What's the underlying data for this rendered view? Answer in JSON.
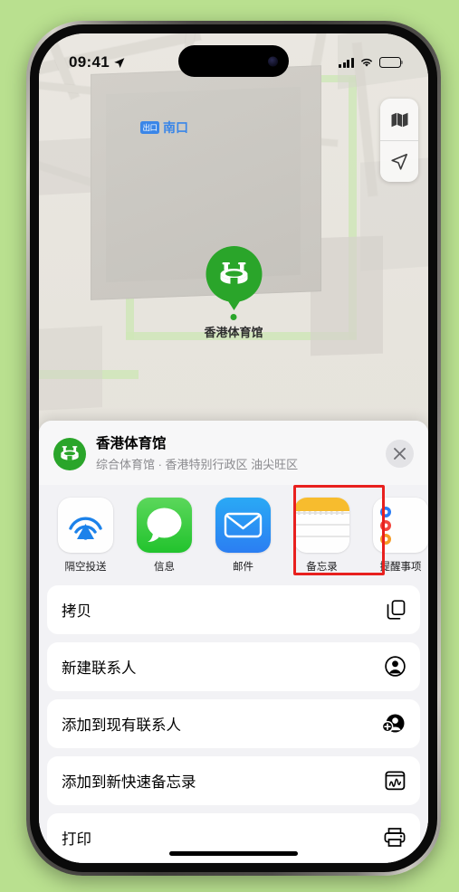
{
  "status_bar": {
    "time": "09:41",
    "location_arrow": "location-arrow-icon",
    "cellular": "cellular-bars-icon",
    "wifi": "wifi-icon",
    "battery": "battery-icon"
  },
  "map": {
    "controls": [
      {
        "name": "map-mode-button",
        "icon": "folded-map-icon"
      },
      {
        "name": "recenter-button",
        "icon": "navigation-arrow-icon"
      }
    ],
    "exit_label": {
      "badge": "出口",
      "text": "南口"
    },
    "pin": {
      "label": "香港体育馆",
      "icon": "stadium-icon",
      "color": "#2aa52a"
    }
  },
  "share_sheet": {
    "title": "香港体育馆",
    "subtitle": "综合体育馆 · 香港特别行政区 油尖旺区",
    "avatar_icon": "stadium-icon",
    "close_label": "✕",
    "apps": [
      {
        "label": "隔空投送",
        "icon": "airdrop-icon",
        "highlighted": false
      },
      {
        "label": "信息",
        "icon": "messages-icon",
        "highlighted": false
      },
      {
        "label": "邮件",
        "icon": "mail-icon",
        "highlighted": false
      },
      {
        "label": "备忘录",
        "icon": "notes-icon",
        "highlighted": true
      },
      {
        "label": "提醒事项",
        "icon": "reminders-icon",
        "highlighted": false
      }
    ],
    "action_groups": [
      {
        "rows": [
          {
            "label": "拷贝",
            "icon": "copy-icon"
          }
        ]
      },
      {
        "rows": [
          {
            "label": "新建联系人",
            "icon": "person-circle-icon"
          }
        ]
      },
      {
        "rows": [
          {
            "label": "添加到现有联系人",
            "icon": "person-add-icon"
          }
        ]
      },
      {
        "rows": [
          {
            "label": "添加到新快速备忘录",
            "icon": "quick-note-icon"
          }
        ]
      },
      {
        "rows": [
          {
            "label": "打印",
            "icon": "printer-icon"
          }
        ]
      }
    ]
  },
  "colors": {
    "background": "#b9e08f",
    "accent_green": "#2aa52a",
    "highlight_red": "#e8201e",
    "transit_blue": "#3a86e8"
  }
}
